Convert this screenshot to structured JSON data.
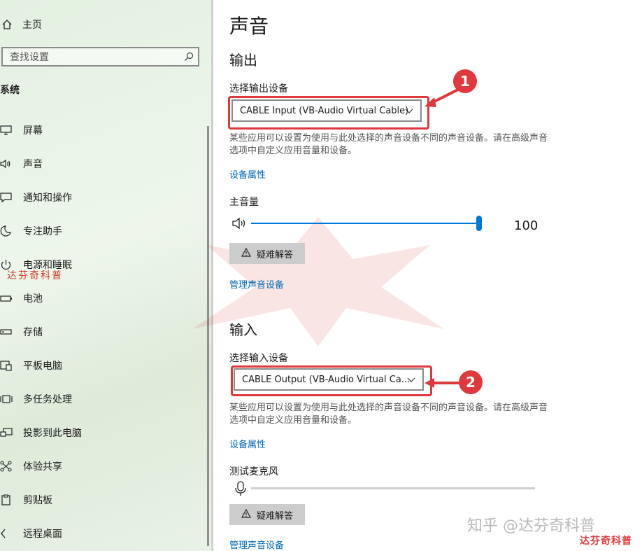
{
  "sidebar": {
    "home_label": "主页",
    "search_placeholder": "查找设置",
    "section_title": "系统",
    "items": [
      {
        "label": "屏幕",
        "icon": "monitor-icon"
      },
      {
        "label": "声音",
        "icon": "speaker-icon"
      },
      {
        "label": "通知和操作",
        "icon": "message-icon"
      },
      {
        "label": "专注助手",
        "icon": "moon-icon"
      },
      {
        "label": "电源和睡眠",
        "icon": "power-icon"
      },
      {
        "label": "电池",
        "icon": "battery-icon"
      },
      {
        "label": "存储",
        "icon": "storage-icon"
      },
      {
        "label": "平板电脑",
        "icon": "tablet-icon"
      },
      {
        "label": "多任务处理",
        "icon": "multitask-icon"
      },
      {
        "label": "投影到此电脑",
        "icon": "project-icon"
      },
      {
        "label": "体验共享",
        "icon": "share-icon"
      },
      {
        "label": "剪贴板",
        "icon": "clipboard-icon"
      },
      {
        "label": "远程桌面",
        "icon": "remote-icon"
      }
    ],
    "watermark": "达芬奇科普"
  },
  "main": {
    "title": "声音",
    "output": {
      "heading": "输出",
      "device_label": "选择输出设备",
      "device_value": "CABLE Input (VB-Audio Virtual Cable)",
      "description": "某些应用可以设置为使用与此处选择的声音设备不同的声音设备。请在高级声音选项中自定义应用音量和设备。",
      "properties_link": "设备属性",
      "volume_label": "主音量",
      "volume_value": "100",
      "volume_fraction": 1.0,
      "troubleshoot_label": "疑难解答",
      "manage_link": "管理声音设备",
      "annotation": "1"
    },
    "input": {
      "heading": "输入",
      "device_label": "选择输入设备",
      "device_value": "CABLE Output (VB-Audio Virtual Ca...",
      "description": "某些应用可以设置为使用与此处选择的声音设备不同的声音设备。请在高级声音选项中自定义应用音量和设备。",
      "properties_link": "设备属性",
      "mic_test_label": "测试麦克风",
      "troubleshoot_label": "疑难解答",
      "manage_link": "管理声音设备",
      "annotation": "2"
    },
    "watermark_zhihu": "知乎 @达芬奇科普",
    "watermark_corner": "达芬奇科普"
  },
  "colors": {
    "accent": "#0078d7",
    "link": "#0067b8",
    "highlight_red": "#e0393d"
  }
}
